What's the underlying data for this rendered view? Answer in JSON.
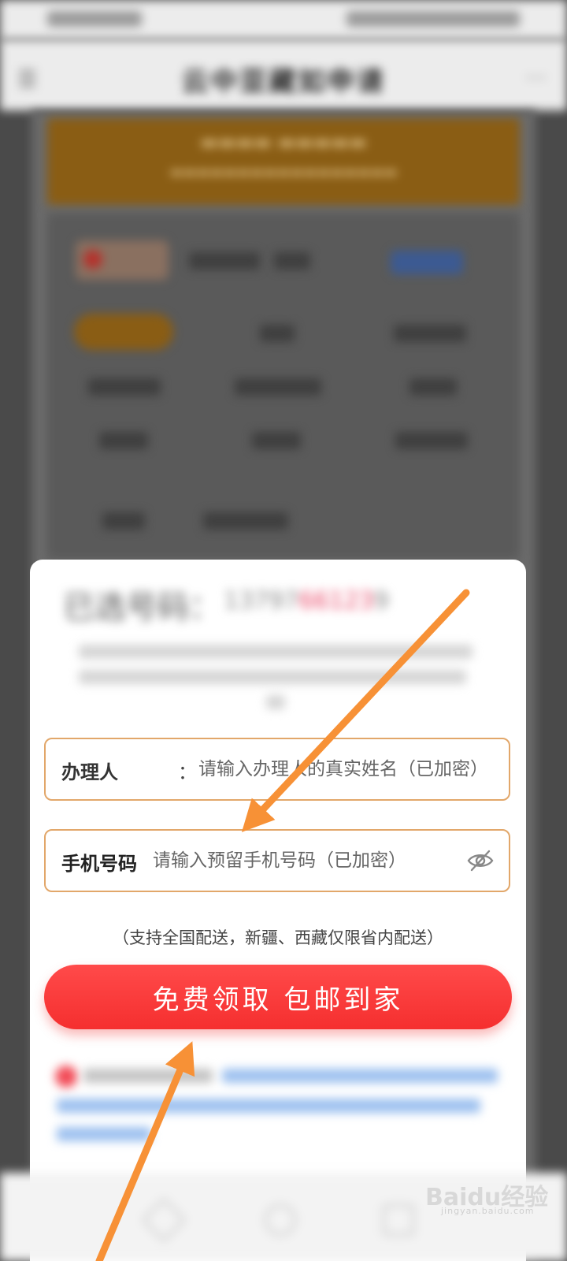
{
  "header": {
    "title": "云中亚藏如申请"
  },
  "bottom_sheet": {
    "selected_label": "已选号码：",
    "selected_number_start": "13797",
    "selected_number_highlight": "66123",
    "selected_number_end": "9"
  },
  "form": {
    "name_label": "办理人",
    "name_colon": "：",
    "name_placeholder": "请输入办理人的真实姓名（已加密）",
    "phone_label": "手机号码",
    "phone_placeholder": "请输入预留手机号码（已加密）"
  },
  "delivery_note": "（支持全国配送，新疆、西藏仅限省内配送）",
  "cta_label": "免费领取 包邮到家",
  "watermark": {
    "text": "Baidu经验",
    "sub": "jingyan.baidu.com"
  },
  "colors": {
    "cta": "#f52f2f",
    "field_border": "#e2a76a",
    "arrow": "#f79136",
    "banner": "#8a5d14"
  },
  "icons": [
    "menu-icon",
    "more-icon",
    "eye-off-icon",
    "back-icon",
    "home-icon",
    "recent-icon"
  ]
}
